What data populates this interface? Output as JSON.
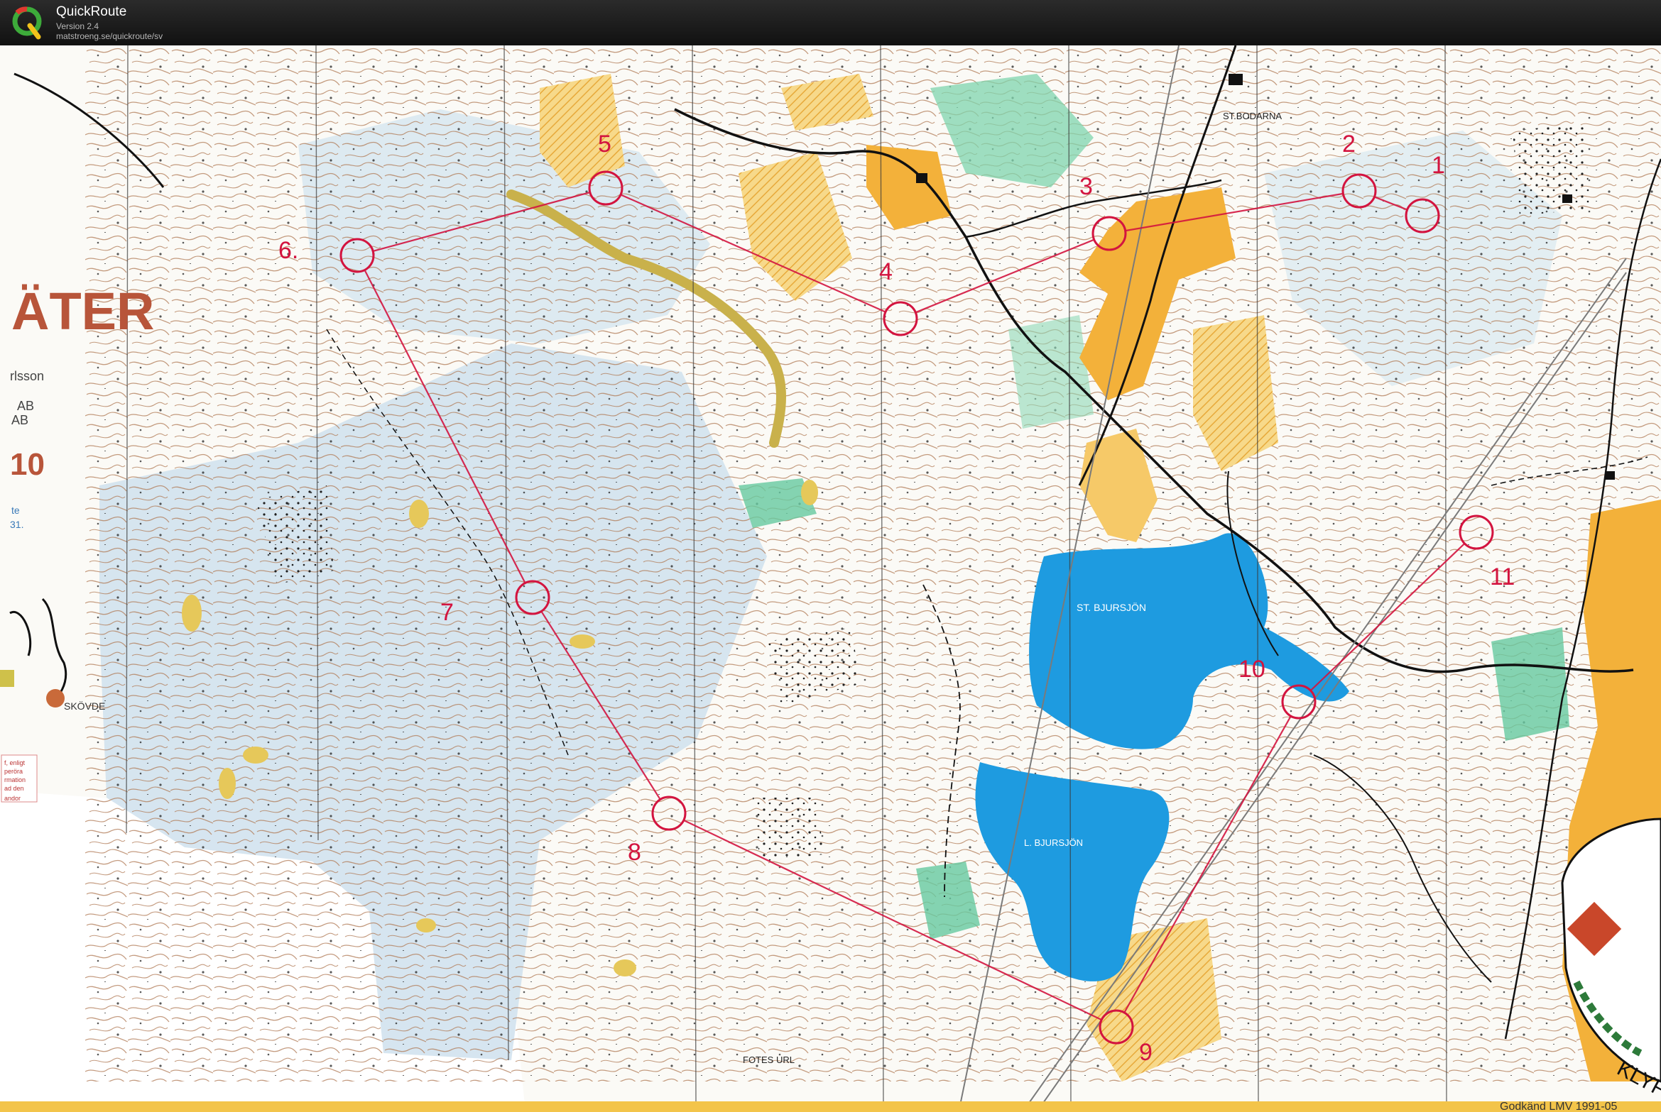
{
  "app": {
    "title": "QuickRoute",
    "version": "Version 2.4",
    "url": "matstroeng.se/quickroute/sv"
  },
  "map": {
    "title_fragment": "ÄTER",
    "legend_fragments": [
      "rlsson",
      "AB",
      "AB",
      "10",
      "te",
      "31."
    ],
    "locator_place": "SKÖVDE",
    "notice_lines": [
      "f, enligt",
      "peröra",
      "rmation",
      "ad den"
    ],
    "notice_foot": "andor",
    "place_names": {
      "st_bodarna": "ST.BODARNA",
      "st_bjursjon": "ST. BJURSJÖN",
      "l_bjursjon": "L. BJURSJÖN",
      "fotes_url": "FOTES URL"
    },
    "club_fragment": "KLYF",
    "approval_text": "Godkänd LMV 1991-05",
    "controls": [
      {
        "number": "1"
      },
      {
        "number": "2"
      },
      {
        "number": "3"
      },
      {
        "number": "4"
      },
      {
        "number": "5"
      },
      {
        "number": "6."
      },
      {
        "number": "7"
      },
      {
        "number": "8"
      },
      {
        "number": "9"
      },
      {
        "number": "10"
      },
      {
        "number": "11"
      }
    ],
    "colors": {
      "course": "#d3143f",
      "water": "#1e9be0",
      "marsh_tint": "#b9d6e8",
      "open_land": "#f3b13a",
      "green": "#66c9a0",
      "contour": "#b07a55"
    }
  }
}
